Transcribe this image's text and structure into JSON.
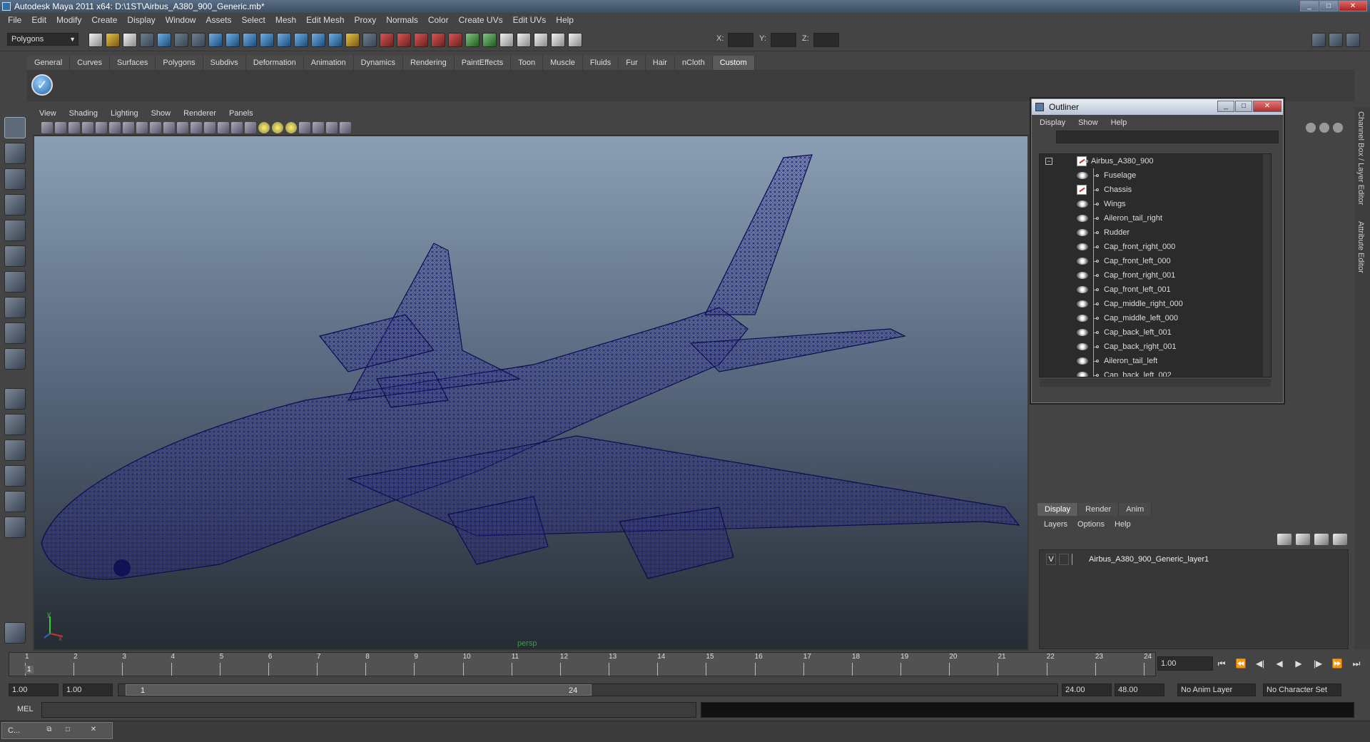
{
  "window": {
    "title": "Autodesk Maya 2011 x64: D:\\1ST\\Airbus_A380_900_Generic.mb*",
    "min": "_",
    "max": "□",
    "close": "✕"
  },
  "menubar": [
    "File",
    "Edit",
    "Modify",
    "Create",
    "Display",
    "Window",
    "Assets",
    "Select",
    "Mesh",
    "Edit Mesh",
    "Proxy",
    "Normals",
    "Color",
    "Create UVs",
    "Edit UVs",
    "Help"
  ],
  "toolbar": {
    "mode": "Polygons",
    "x_label": "X:",
    "y_label": "Y:",
    "z_label": "Z:"
  },
  "shelf_tabs": [
    "General",
    "Curves",
    "Surfaces",
    "Polygons",
    "Subdivs",
    "Deformation",
    "Animation",
    "Dynamics",
    "Rendering",
    "PaintEffects",
    "Toon",
    "Muscle",
    "Fluids",
    "Fur",
    "Hair",
    "nCloth",
    "Custom"
  ],
  "shelf_active": "Custom",
  "viewport_menu": [
    "View",
    "Shading",
    "Lighting",
    "Show",
    "Renderer",
    "Panels"
  ],
  "viewport": {
    "camera": "persp",
    "axis_x": "x",
    "axis_y": "y",
    "mesh_color": "#1a1a6e"
  },
  "outliner": {
    "title": "Outliner",
    "menu": [
      "Display",
      "Show",
      "Help"
    ],
    "root": "Airbus_A380_900",
    "items": [
      "Fuselage",
      "Chassis",
      "Wings",
      "Aileron_tail_right",
      "Rudder",
      "Cap_front_right_000",
      "Cap_front_left_000",
      "Cap_front_right_001",
      "Cap_front_left_001",
      "Cap_middle_right_000",
      "Cap_middle_left_000",
      "Cap_back_left_001",
      "Cap_back_right_001",
      "Aileron_tail_left",
      "Cap_back_left_002"
    ]
  },
  "layer_editor": {
    "tabs": [
      "Display",
      "Render",
      "Anim"
    ],
    "active_tab": "Display",
    "menu": [
      "Layers",
      "Options",
      "Help"
    ],
    "layer": {
      "visible": "V",
      "name": "Airbus_A380_900_Generic_layer1"
    }
  },
  "side_tabs": [
    "Channel Box / Layer Editor",
    "Attribute Editor"
  ],
  "timeline": {
    "ticks": [
      "1",
      "2",
      "3",
      "4",
      "5",
      "6",
      "7",
      "8",
      "9",
      "10",
      "11",
      "12",
      "13",
      "14",
      "15",
      "16",
      "17",
      "18",
      "19",
      "20",
      "21",
      "22",
      "23",
      "24"
    ],
    "current_frame": "1.00",
    "playhead_label": "1"
  },
  "range": {
    "start": "1.00",
    "playback_start": "1.00",
    "handle_start": "1",
    "handle_end": "24",
    "playback_end": "24.00",
    "end": "48.00",
    "anim_layer": "No Anim Layer",
    "char_set": "No Character Set"
  },
  "mel": {
    "label": "MEL"
  },
  "taskbar": {
    "item": "C..."
  }
}
